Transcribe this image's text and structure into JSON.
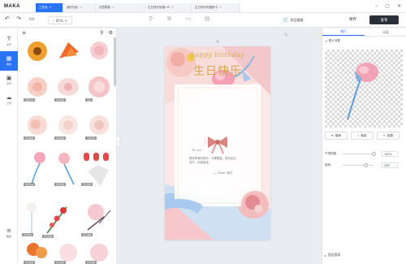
{
  "app": {
    "logo": "MAKA"
  },
  "tabs": [
    {
      "label": "工作台",
      "active": true
    },
    {
      "label": "我的作品"
    },
    {
      "label": "创意模板"
    },
    {
      "label": "生日快乐祝福 H5"
    },
    {
      "label": "生日快乐祝福贺卡"
    }
  ],
  "toolbar": {
    "zoom": "85%",
    "link_label": "作品链接",
    "save_label": "保存",
    "publish_label": "发布"
  },
  "rail": [
    {
      "icon": "T",
      "label": "文字",
      "active": false
    },
    {
      "icon": "▦",
      "label": "素材",
      "active": true
    },
    {
      "icon": "▣",
      "label": "背景",
      "active": false
    },
    {
      "icon": "☁",
      "label": "上传",
      "active": false
    },
    {
      "icon": "≡",
      "label": "图层",
      "active": false
    }
  ],
  "assets": {
    "tags": [
      "风景花卉",
      "花卉素材",
      "花朵",
      "花卉素材",
      "花卉素材",
      "手绘花卉",
      "花卉素材",
      "花卉素材",
      "花卉素材",
      "花卉素材",
      "花卉素材",
      "花卉素材",
      "花卉素材",
      "花卉素材",
      "花卉素材",
      "花卉素材",
      "花卉素材"
    ]
  },
  "card": {
    "greeting_en": "happy birthday",
    "greeting_cn": "生日快乐",
    "dear": "To: xxx",
    "message": "愿你所有的快乐，无需假装，愿你此生尽兴，赤诚善良。",
    "sign": "——From: 我们"
  },
  "right_panel": {
    "tabs": [
      "图片",
      "动画"
    ],
    "section": "图片设置",
    "buttons": [
      "替换",
      "裁剪",
      "抠图"
    ],
    "rows": [
      {
        "label": "不透明度",
        "value": "100%",
        "level": 1.0
      },
      {
        "label": "旋转",
        "value": "259°",
        "level": 0.72
      }
    ],
    "footer": "图层管理"
  },
  "colors": {
    "accent": "#2b73f5",
    "gold": "#d7a74a",
    "publish": "#2b2f3a"
  }
}
